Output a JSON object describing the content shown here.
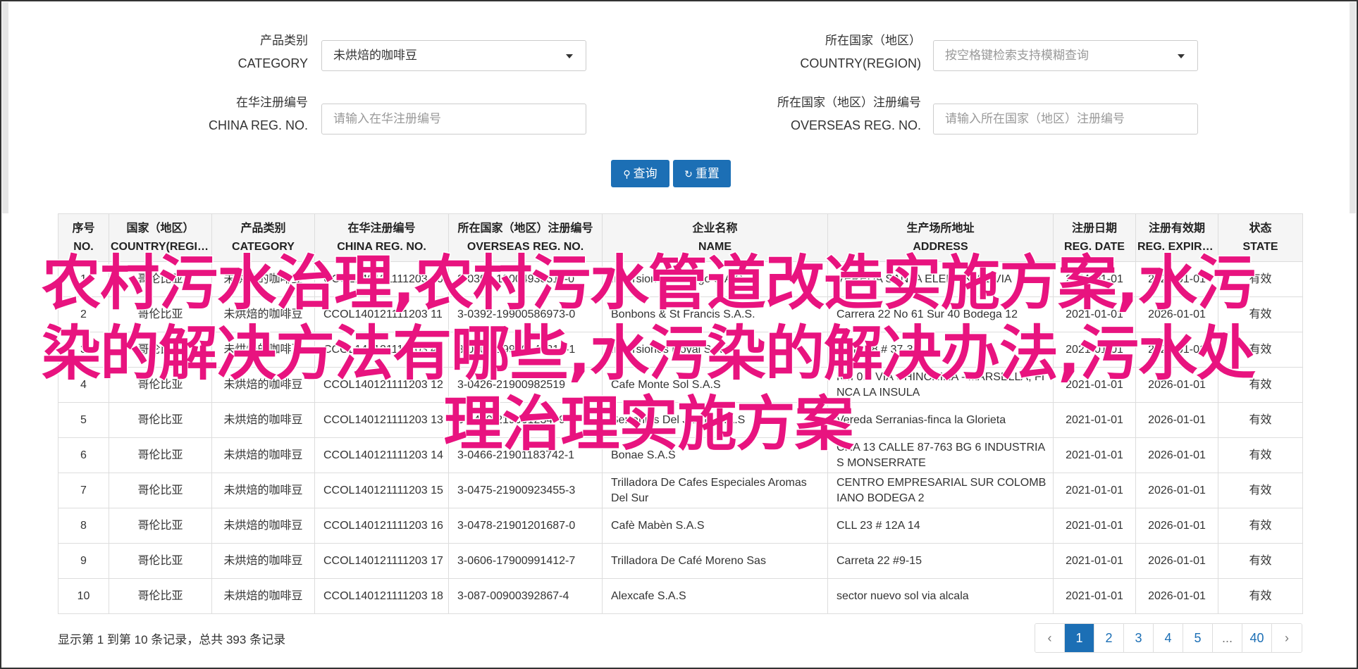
{
  "search": {
    "category_label_cn": "产品类别",
    "category_label_en": "CATEGORY",
    "category_value": "未烘焙的咖啡豆",
    "country_label_cn": "所在国家（地区）",
    "country_label_en": "COUNTRY(REGION)",
    "country_placeholder": "按空格键检索支持模糊查询",
    "china_reg_label_cn": "在华注册编号",
    "china_reg_label_en": "CHINA REG. NO.",
    "china_reg_placeholder": "请输入在华注册编号",
    "overseas_reg_label_cn": "所在国家（地区）注册编号",
    "overseas_reg_label_en": "OVERSEAS REG. NO.",
    "overseas_reg_placeholder": "请输入所在国家（地区）注册编号",
    "query_button": "查询",
    "reset_button": "重置"
  },
  "table": {
    "headers": [
      {
        "cn": "序号",
        "en": "NO."
      },
      {
        "cn": "国家（地区）",
        "en": "COUNTRY(REGIO..."
      },
      {
        "cn": "产品类别",
        "en": "CATEGORY"
      },
      {
        "cn": "在华注册编号",
        "en": "CHINA REG. NO."
      },
      {
        "cn": "所在国家（地区）注册编号",
        "en": "OVERSEAS REG. NO."
      },
      {
        "cn": "企业名称",
        "en": "NAME"
      },
      {
        "cn": "生产场所地址",
        "en": "ADDRESS"
      },
      {
        "cn": "注册日期",
        "en": "REG. DATE"
      },
      {
        "cn": "注册有效期",
        "en": "REG. EXPIRE ..."
      },
      {
        "cn": "状态",
        "en": "STATE"
      }
    ],
    "rows": [
      {
        "no": "1",
        "country": "哥伦比亚",
        "category": "未烘焙的咖啡豆",
        "china_reg": "CCOL140121111203 10",
        "overseas_reg": "3-0390-19004938511-0",
        "name": "Inversiones Gallego S.A.S",
        "address": "VEREDA SANTA ELENA KM 1 VIA",
        "reg_date": "2021-01-01",
        "expire": "2026-01-01",
        "state": "有效"
      },
      {
        "no": "2",
        "country": "哥伦比亚",
        "category": "未烘焙的咖啡豆",
        "china_reg": "CCOL140121111203 11",
        "overseas_reg": "3-0392-19900586973-0",
        "name": "Bonbons & St Francis S.A.S.",
        "address": "Carrera 22 No 61 Sur 40 Bodega 12",
        "reg_date": "2021-01-01",
        "expire": "2026-01-01",
        "state": "有效"
      },
      {
        "no": "3",
        "country": "哥伦比亚",
        "category": "未烘焙的咖啡豆",
        "china_reg": "CCOL140121111203 47",
        "overseas_reg": "3-0401-19900148312-1",
        "name": "Inversiones Royal S.A.S",
        "address": "Calle 28 # 37-36",
        "reg_date": "2021-01-01",
        "expire": "2026-01-01",
        "state": "有效"
      },
      {
        "no": "4",
        "country": "哥伦比亚",
        "category": "未烘焙的咖啡豆",
        "china_reg": "CCOL140121111203 12",
        "overseas_reg": "3-0426-21900982519",
        "name": "Cafe Monte Sol S.A.S",
        "address": "KM 0.5 VÍA CHINCHINA - MARSELLA, FINCA LA INSULA",
        "reg_date": "2021-01-01",
        "expire": "2026-01-01",
        "state": "有效"
      },
      {
        "no": "5",
        "country": "哥伦比亚",
        "category": "未烘焙的咖啡豆",
        "china_reg": "CCOL140121111203 13",
        "overseas_reg": "3-0440-21900123479",
        "name": "Serranias Del Jardin S.A.S",
        "address": "Vereda Serranias-finca la Glorieta",
        "reg_date": "2021-01-01",
        "expire": "2026-01-01",
        "state": "有效"
      },
      {
        "no": "6",
        "country": "哥伦比亚",
        "category": "未烘焙的咖啡豆",
        "china_reg": "CCOL140121111203 14",
        "overseas_reg": "3-0466-21901183742-1",
        "name": "Bonae S.A.S",
        "address": "CRA 13 CALLE 87-763 BG 6 INDUSTRIAS MONSERRATE",
        "reg_date": "2021-01-01",
        "expire": "2026-01-01",
        "state": "有效"
      },
      {
        "no": "7",
        "country": "哥伦比亚",
        "category": "未烘焙的咖啡豆",
        "china_reg": "CCOL140121111203 15",
        "overseas_reg": "3-0475-21900923455-3",
        "name": "Trilladora De Cafes Especiales Aromas Del Sur",
        "address": "CENTRO EMPRESARIAL SUR COLOMBIANO BODEGA 2",
        "reg_date": "2021-01-01",
        "expire": "2026-01-01",
        "state": "有效"
      },
      {
        "no": "8",
        "country": "哥伦比亚",
        "category": "未烘焙的咖啡豆",
        "china_reg": "CCOL140121111203 16",
        "overseas_reg": "3-0478-21901201687-0",
        "name": "Cafè Mabèn S.A.S",
        "address": "CLL 23 # 12A 14",
        "reg_date": "2021-01-01",
        "expire": "2026-01-01",
        "state": "有效"
      },
      {
        "no": "9",
        "country": "哥伦比亚",
        "category": "未烘焙的咖啡豆",
        "china_reg": "CCOL140121111203 17",
        "overseas_reg": "3-0606-17900991412-7",
        "name": "Trilladora De Café Moreno Sas",
        "address": "Carreta 22 #9-15",
        "reg_date": "2021-01-01",
        "expire": "2026-01-01",
        "state": "有效"
      },
      {
        "no": "10",
        "country": "哥伦比亚",
        "category": "未烘焙的咖啡豆",
        "china_reg": "CCOL140121111203 18",
        "overseas_reg": "3-087-00900392867-4",
        "name": "Alexcafe S.A.S",
        "address": "sector nuevo sol via alcala",
        "reg_date": "2021-01-01",
        "expire": "2026-01-01",
        "state": "有效"
      }
    ]
  },
  "footer": {
    "summary": "显示第 1 到第 10 条记录，总共 393 条记录",
    "pages": [
      "‹",
      "1",
      "2",
      "3",
      "4",
      "5",
      "...",
      "40",
      "›"
    ],
    "active_page": "1"
  },
  "overlay": {
    "text": "农村污水治理,农村污水管道改造实施方案,水污染的解决方法有哪些,水污染的解决办法,污水处理治理实施方案"
  },
  "colors": {
    "primary": "#1c6fb5",
    "overlay": "#e8137f",
    "header_bg": "#f5f5f5",
    "border": "#dddddd"
  }
}
